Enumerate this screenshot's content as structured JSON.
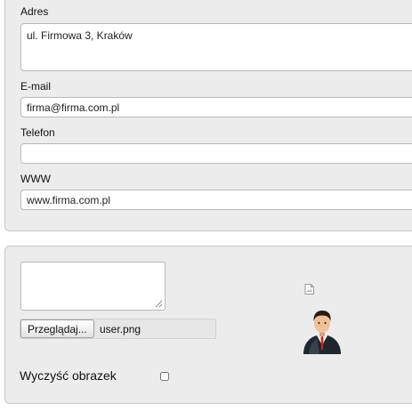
{
  "contact": {
    "address_label": "Adres",
    "address_value": "ul. Firmowa 3, Kraków",
    "email_label": "E-mail",
    "email_value": "firma@firma.com.pl",
    "phone_label": "Telefon",
    "phone_value": "",
    "www_label": "WWW",
    "www_value": "www.firma.com.pl"
  },
  "image": {
    "browse_label": "Przeglądaj...",
    "file_name": "user.png",
    "clear_label": "Wyczyść obrazek",
    "clear_checked": false,
    "avatar_icon": "user-avatar-icon",
    "broken_icon": "broken-image-icon"
  }
}
